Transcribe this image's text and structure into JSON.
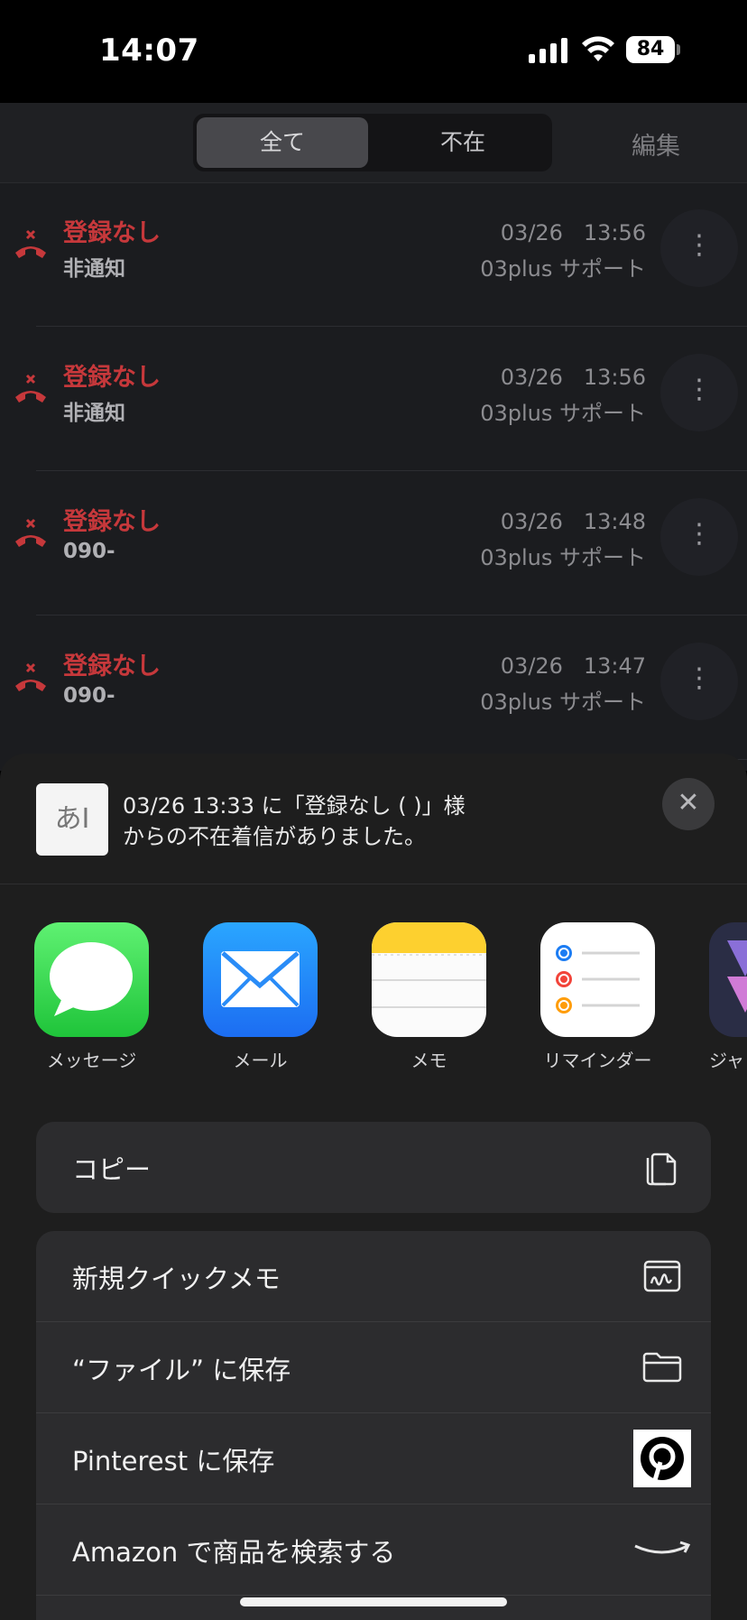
{
  "status": {
    "time": "14:07",
    "battery": "84"
  },
  "header": {
    "tabs": [
      "全て",
      "不在"
    ],
    "edit": "編集"
  },
  "calls": [
    {
      "name": "登録なし",
      "number": "非通知",
      "datetime": "03/26   13:56",
      "line": "03plus サポート"
    },
    {
      "name": "登録なし",
      "number": "非通知",
      "datetime": "03/26   13:56",
      "line": "03plus サポート"
    },
    {
      "name": "登録なし",
      "number": "090-",
      "datetime": "03/26   13:48",
      "line": "03plus サポート"
    },
    {
      "name": "登録なし",
      "number": "090-",
      "datetime": "03/26   13:47",
      "line": "03plus サポート"
    }
  ],
  "share": {
    "thumb": "あI",
    "message_line1": "03/26 13:33 に「登録なし (                      )」様",
    "message_line2": "からの不在着信がありました。",
    "apps": [
      {
        "label": "メッセージ",
        "icon": "messages-icon"
      },
      {
        "label": "メール",
        "icon": "mail-icon"
      },
      {
        "label": "メモ",
        "icon": "notes-icon"
      },
      {
        "label": "リマインダー",
        "icon": "reminders-icon"
      },
      {
        "label": "ジャ",
        "icon": "shortcuts-icon"
      }
    ],
    "copy": "コピー",
    "actions": [
      {
        "label": "新規クイックメモ",
        "icon": "quick-note-icon"
      },
      {
        "label": "“ファイル” に保存",
        "icon": "folder-icon"
      },
      {
        "label": "Pinterest に保存",
        "icon": "pinterest-icon"
      },
      {
        "label": "Amazon で商品を検索する",
        "icon": "amazon-icon"
      }
    ]
  },
  "colors": {
    "missed": "#c6383b",
    "sheet": "#1e1e1e",
    "group": "#2c2c2e"
  }
}
